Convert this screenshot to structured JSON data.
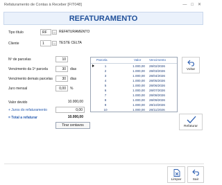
{
  "window": {
    "title": "Refaturamento de Contas à Receber [FIT048]",
    "controls": [
      "—",
      "□",
      "✕"
    ]
  },
  "banner": {
    "title": "REFATURAMENTO"
  },
  "form": {
    "tipo_titulo": {
      "label": "Tipo título",
      "code": "RF",
      "description": "REFATURAMENTO"
    },
    "cliente": {
      "label": "Cliente",
      "code": "1",
      "description": "TESTE CELTA"
    },
    "ellipsis": "...",
    "parcelas": {
      "label": "Nº de parcelas",
      "value": "10"
    },
    "vencimento_primeira": {
      "label": "Vencimento da 1ª parcela",
      "value": "30",
      "unit": "dias"
    },
    "vencimento_demais": {
      "label": "Vencimento demais parcelas",
      "value": "30",
      "unit": "dias"
    },
    "juro": {
      "label": "Juro mensal",
      "value": "0,00",
      "unit": "%"
    },
    "valor_devido": {
      "label": "Valor devido",
      "value": "10.000,00"
    },
    "juros_refaturamento": {
      "label": "+ Juros do refaturamento",
      "value": "0,00"
    },
    "total": {
      "label": "= Total a refaturar",
      "value": "10.000,00"
    },
    "tirar_centavos": "Tirar centavos"
  },
  "grid": {
    "headers": {
      "parcela": "Parcela",
      "valor": "Valor",
      "vencimento": "Vencimento"
    },
    "rows": [
      {
        "parcela": "1",
        "valor": "1.000,00",
        "vencimento": "28/02/2026"
      },
      {
        "parcela": "2",
        "valor": "1.000,00",
        "vencimento": "28/03/2026"
      },
      {
        "parcela": "3",
        "valor": "1.000,00",
        "vencimento": "28/04/2026"
      },
      {
        "parcela": "4",
        "valor": "1.000,00",
        "vencimento": "28/05/2026"
      },
      {
        "parcela": "5",
        "valor": "1.000,00",
        "vencimento": "28/06/2026"
      },
      {
        "parcela": "6",
        "valor": "1.000,00",
        "vencimento": "28/07/2026"
      },
      {
        "parcela": "7",
        "valor": "1.000,00",
        "vencimento": "28/08/2026"
      },
      {
        "parcela": "8",
        "valor": "1.000,00",
        "vencimento": "28/09/2026"
      },
      {
        "parcela": "9",
        "valor": "1.000,00",
        "vencimento": "28/10/2026"
      },
      {
        "parcela": "10",
        "valor": "1.000,00",
        "vencimento": "28/11/2026"
      }
    ]
  },
  "buttons": {
    "voltar": "Voltar",
    "refaturar": "Refaturar",
    "limpar": "Limpar",
    "sair": "Sair"
  },
  "colors": {
    "accent": "#2a5db0",
    "banner_bg": "#eaf1fb"
  }
}
